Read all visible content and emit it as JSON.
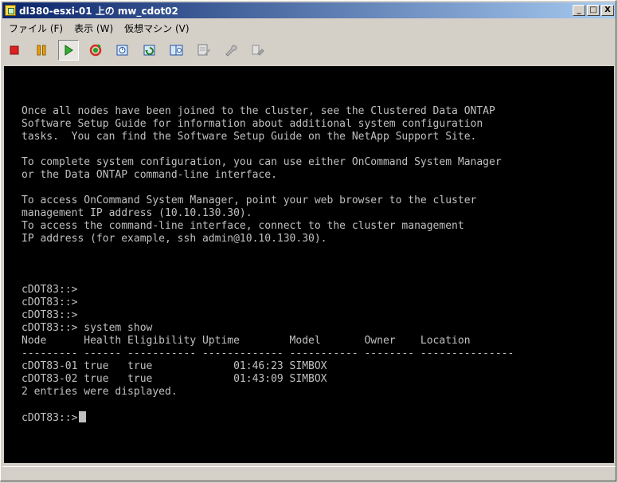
{
  "window": {
    "title": "dl380-esxi-01 上の mw_cdot02",
    "minimize": "_",
    "maximize": "□",
    "close": "X"
  },
  "menu": {
    "file": "ファイル (F)",
    "view": "表示 (W)",
    "vm": "仮想マシン (V)"
  },
  "toolbar": {
    "icons": [
      "stop-icon",
      "pause-icon",
      "play-icon",
      "reset-icon",
      "snapshot-icon",
      "revert-snapshot-icon",
      "snapshot-manager-icon",
      "console-settings-icon",
      "tools-icon",
      "vm-options-icon"
    ],
    "colors": {
      "stop": "#e02020",
      "pause": "#f0a000",
      "play": "#20a020",
      "reset": "#20a020"
    }
  },
  "console": {
    "lines": [
      "Once all nodes have been joined to the cluster, see the Clustered Data ONTAP",
      "Software Setup Guide for information about additional system configuration",
      "tasks.  You can find the Software Setup Guide on the NetApp Support Site.",
      "",
      "To complete system configuration, you can use either OnCommand System Manager",
      "or the Data ONTAP command-line interface.",
      "",
      "To access OnCommand System Manager, point your web browser to the cluster",
      "management IP address (10.10.130.30).",
      "To access the command-line interface, connect to the cluster management",
      "IP address (for example, ssh admin@10.10.130.30).",
      "",
      "",
      "",
      "cDOT83::>",
      "cDOT83::>",
      "cDOT83::>",
      "cDOT83::> system show",
      "Node      Health Eligibility Uptime        Model       Owner    Location",
      "--------- ------ ----------- ------------- ----------- -------- ---------------",
      "cDOT83-01 true   true             01:46:23 SIMBOX",
      "cDOT83-02 true   true             01:43:09 SIMBOX",
      "2 entries were displayed.",
      ""
    ],
    "prompt": "cDOT83::>"
  }
}
